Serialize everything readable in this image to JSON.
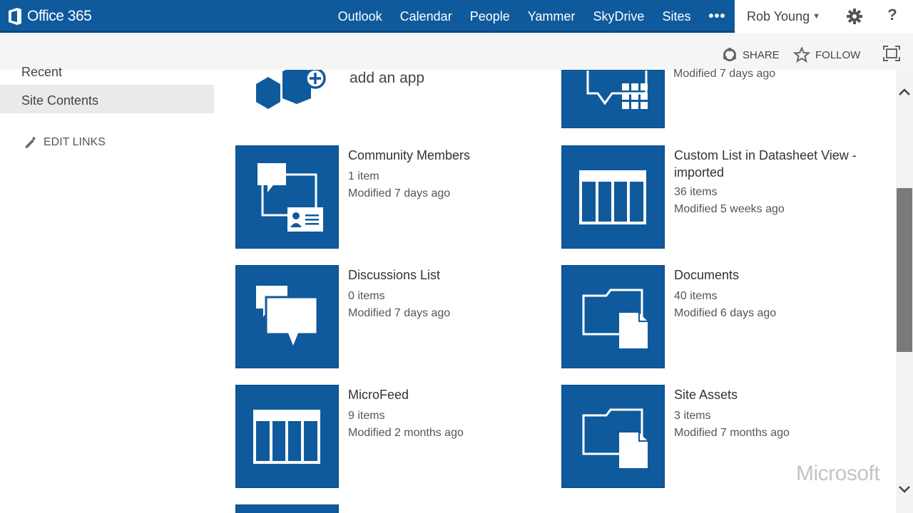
{
  "suitebar": {
    "brand": "Office 365",
    "nav": [
      "Outlook",
      "Calendar",
      "People",
      "Yammer",
      "SkyDrive",
      "Sites"
    ],
    "more": "•••",
    "user": "Rob Young",
    "help": "?"
  },
  "actions": {
    "share": "SHARE",
    "follow": "FOLLOW"
  },
  "leftnav": {
    "recent": "Recent",
    "site_contents": "Site Contents",
    "edit_links": "EDIT LINKS"
  },
  "add_app": {
    "label": "add an app"
  },
  "tiles": [
    {
      "title": "",
      "count": "",
      "modified": "Modified 7 days ago"
    },
    {
      "title": "Community Members",
      "count": "1 item",
      "modified": "Modified 7 days ago"
    },
    {
      "title": "Custom List in Datasheet View - imported",
      "count": "36 items",
      "modified": "Modified 5 weeks ago"
    },
    {
      "title": "Discussions List",
      "count": "0 items",
      "modified": "Modified 7 days ago"
    },
    {
      "title": "Documents",
      "count": "40 items",
      "modified": "Modified 6 days ago"
    },
    {
      "title": "MicroFeed",
      "count": "9 items",
      "modified": "Modified 2 months ago"
    },
    {
      "title": "Site Assets",
      "count": "3 items",
      "modified": "Modified 7 months ago"
    }
  ],
  "watermark": "Microsoft",
  "colors": {
    "brand_blue": "#0f5a9c",
    "tile_blue": "#0f5a9c"
  }
}
